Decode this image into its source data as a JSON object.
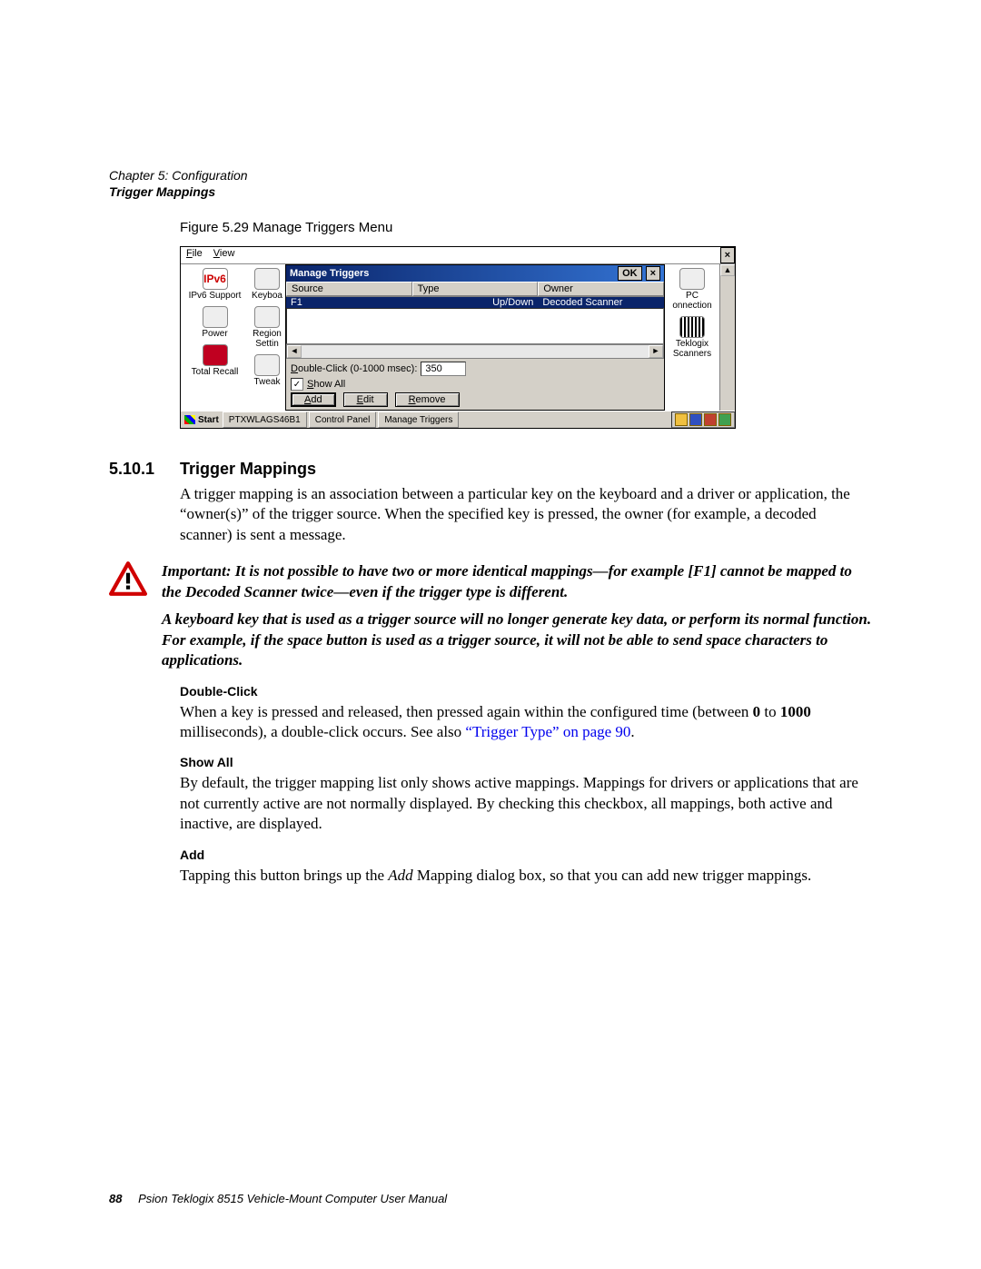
{
  "header": {
    "chapter_line": "Chapter 5: Configuration",
    "section_line": "Trigger Mappings"
  },
  "figure_caption": "Figure 5.29 Manage Triggers Menu",
  "screenshot": {
    "menubar": {
      "file": "File",
      "view": "View"
    },
    "window_ok": "OK",
    "window_close": "×",
    "outer_close": "×",
    "left_icons": [
      {
        "label": "IPv6 Support"
      },
      {
        "label": "Power"
      },
      {
        "label": "Total Recall"
      }
    ],
    "left_icons_col2": [
      {
        "label": "Keyboa"
      },
      {
        "label": "Region Settin"
      },
      {
        "label": "Tweak"
      }
    ],
    "right_icons": [
      {
        "label": "PC onnection"
      },
      {
        "label": "Teklogix Scanners"
      }
    ],
    "dialog": {
      "title": "Manage Triggers",
      "columns": {
        "source": "Source",
        "type": "Type",
        "owner": "Owner"
      },
      "row": {
        "source": "F1",
        "type": "Up/Down",
        "owner": "Decoded Scanner"
      },
      "dblclick_label": "Double-Click (0-1000 msec):",
      "dblclick_value": "350",
      "show_all_label": "Show All",
      "buttons": {
        "add": "Add",
        "edit": "Edit",
        "remove": "Remove"
      }
    },
    "taskbar": {
      "start": "Start",
      "items": [
        "PTXWLAGS46B1",
        "Control Panel",
        "Manage Triggers"
      ]
    }
  },
  "section": {
    "number": "5.10.1",
    "title": "Trigger Mappings",
    "intro": "A trigger mapping is an association between a particular key on the keyboard and a driver or application, the “owner(s)” of the trigger source. When the specified key is pressed, the owner (for example, a decoded scanner) is sent a message."
  },
  "important": {
    "label": "Important:",
    "p1": "It is not possible to have two or more identical mappings—for example [F1] cannot be mapped to the Decoded Scanner twice—even if the trigger type is different.",
    "p2": "A keyboard key that is used as a trigger source will no longer generate key data, or perform its normal function. For example, if the space button is used as a trigger source, it will not be able to send space characters to applications."
  },
  "double_click": {
    "heading": "Double-Click",
    "text_pre": "When a key is pressed and released, then pressed again within the configured time (between ",
    "zero": "0",
    "to": " to ",
    "thousand": "1000",
    "text_mid": " milliseconds), a double-click occurs. See also ",
    "link": "“Trigger Type” on page 90",
    "text_post": "."
  },
  "show_all": {
    "heading": "Show All",
    "text": "By default, the trigger mapping list only shows active mappings. Mappings for drivers or applications that are not currently active are not normally displayed. By checking this checkbox, all mappings, both active and inactive, are displayed."
  },
  "add": {
    "heading": "Add",
    "text_pre": "Tapping this button brings up the ",
    "em": "Add",
    "text_post": " Mapping dialog box, so that you can add new trigger mappings."
  },
  "footer": {
    "page": "88",
    "text": "Psion Teklogix 8515 Vehicle-Mount Computer User Manual"
  }
}
